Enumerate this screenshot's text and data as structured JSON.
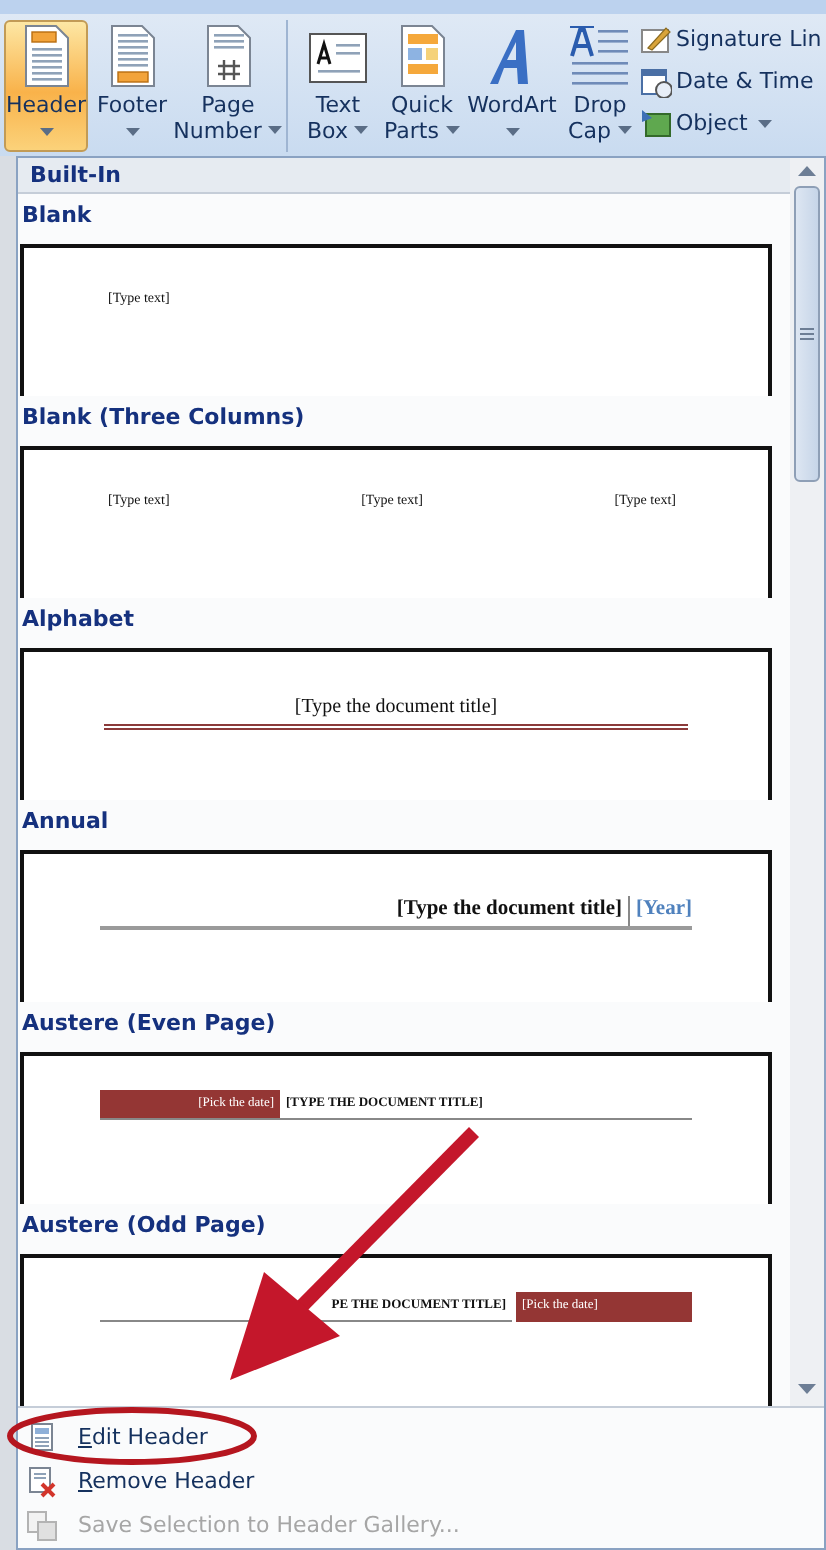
{
  "ribbon": {
    "groups": [
      {
        "buttons": [
          {
            "lines": [
              "Header"
            ],
            "caret": true,
            "selected": true
          },
          {
            "lines": [
              "Footer"
            ],
            "caret": true,
            "selected": false
          },
          {
            "lines": [
              "Page",
              "Number"
            ],
            "caret": true,
            "selected": false
          }
        ]
      },
      {
        "buttons": [
          {
            "lines": [
              "Text",
              "Box"
            ],
            "caret": true,
            "selected": false
          },
          {
            "lines": [
              "Quick",
              "Parts"
            ],
            "caret": true,
            "selected": false
          },
          {
            "lines": [
              "WordArt"
            ],
            "caret": true,
            "selected": false
          },
          {
            "lines": [
              "Drop",
              "Cap"
            ],
            "caret": true,
            "selected": false
          }
        ],
        "small_buttons": [
          {
            "label": "Signature Lin",
            "caret": false
          },
          {
            "label": "Date & Time",
            "caret": false
          },
          {
            "label": "Object",
            "caret": true
          }
        ]
      }
    ]
  },
  "gallery": {
    "heading": "Built-In",
    "items": [
      {
        "label": "Blank",
        "kind": "blank",
        "texts": [
          "[Type text]"
        ]
      },
      {
        "label": "Blank (Three Columns)",
        "kind": "three_columns",
        "texts": [
          "[Type text]",
          "[Type text]",
          "[Type text]"
        ]
      },
      {
        "label": "Alphabet",
        "kind": "alphabet",
        "texts": [
          "[Type the document title]"
        ]
      },
      {
        "label": "Annual",
        "kind": "annual",
        "texts": [
          "[Type the document title]",
          "[Year]"
        ]
      },
      {
        "label": "Austere (Even Page)",
        "kind": "austere_even",
        "texts": [
          "[Pick the date]",
          "[TYPE THE DOCUMENT TITLE]"
        ]
      },
      {
        "label": "Austere (Odd Page)",
        "kind": "austere_odd",
        "texts": [
          "PE THE DOCUMENT TITLE]",
          "[Pick the date]"
        ]
      }
    ]
  },
  "menu": [
    {
      "label": "Edit Header",
      "underline_first_letter": true,
      "disabled": false
    },
    {
      "label": "Remove Header",
      "underline_first_letter": true,
      "disabled": false
    },
    {
      "label": "Save Selection to Header Gallery...",
      "underline_first_letter": false,
      "disabled": true
    }
  ]
}
